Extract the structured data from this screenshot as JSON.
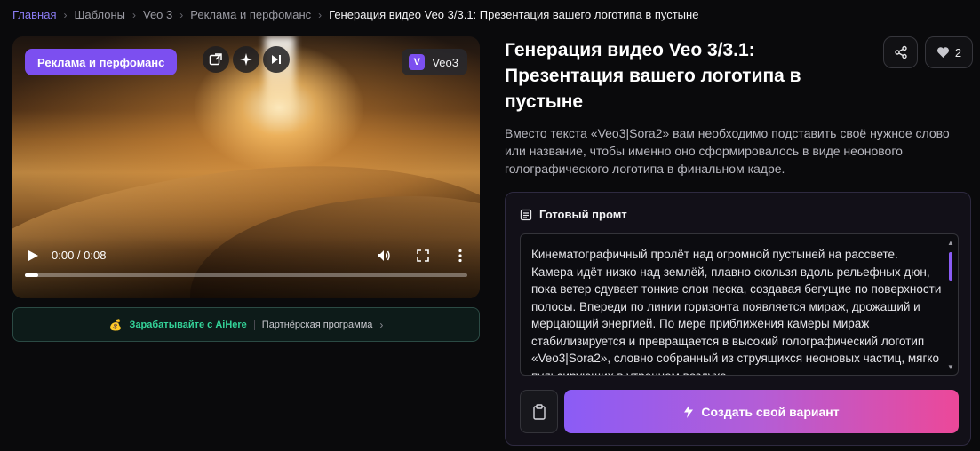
{
  "breadcrumb": {
    "items": [
      "Главная",
      "Шаблоны",
      "Veo 3",
      "Реклама и перфоманс"
    ],
    "current": "Генерация видео Veo 3/3.1: Презентация вашего логотипа в пустыне"
  },
  "video": {
    "category_tag": "Реклама и перфоманс",
    "model_badge": "Veo3",
    "model_badge_letter": "V",
    "time": "0:00 / 0:08",
    "progress": 0.03
  },
  "affiliate": {
    "earn_label": "Зарабатывайте с AiHere",
    "program_label": "Партнёрская программа"
  },
  "page": {
    "title": "Генерация видео Veo 3/3.1: Презентация вашего логотипа в пустыне",
    "likes": "2",
    "description": "Вместо текста «Veo3|Sora2» вам необходимо подставить своё нужное слово или название, чтобы именно оно сформировалось в виде неонового голографического логотипа в финальном кадре."
  },
  "prompt": {
    "heading": "Готовый промт",
    "text": "Кинематографичный пролёт над огромной пустыней на рассвете. Камера идёт низко над землёй, плавно скользя вдоль рельефных дюн, пока ветер сдувает тонкие слои песка, создавая бегущие по поверхности полосы. Впереди по линии горизонта появляется мираж, дрожащий и мерцающий энергией. По мере приближения камеры мираж стабилизируется и превращается в высокий голографический логотип «Veo3|Sora2», словно собранный из струящихся неоновых частиц, мягко пульсирующих в утреннем воздухе.",
    "create_button": "Создать свой вариант"
  },
  "colors": {
    "accent": "#7c4ff0",
    "gradient_start": "#8b5cf6",
    "gradient_end": "#ec4899",
    "earn": "#34d399"
  },
  "icons": [
    "pip-icon",
    "sparkle-icon",
    "skip-forward-icon",
    "play-icon",
    "volume-icon",
    "fullscreen-icon",
    "more-vertical-icon",
    "coin-icon",
    "chevron-right-icon",
    "share-icon",
    "heart-icon",
    "document-icon",
    "clipboard-icon",
    "lightning-icon"
  ]
}
